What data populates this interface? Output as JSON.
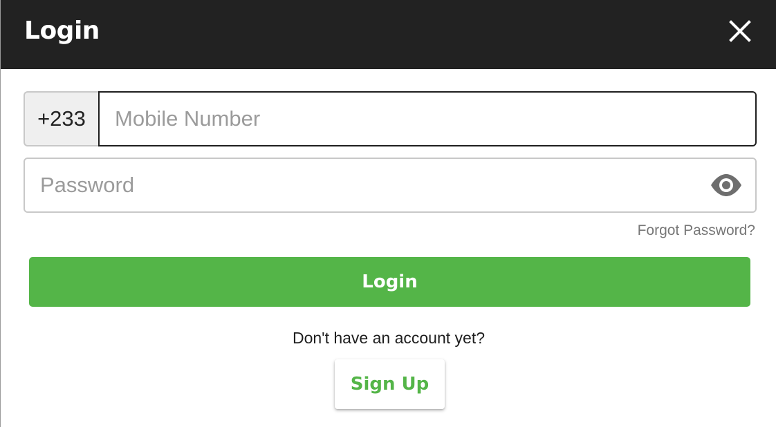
{
  "header": {
    "title": "Login"
  },
  "icons": {
    "close": "close-icon",
    "visibility": "eye-icon"
  },
  "form": {
    "country_code": "+233",
    "mobile_placeholder": "Mobile Number",
    "mobile_value": "",
    "password_placeholder": "Password",
    "password_value": "",
    "forgot_password_label": "Forgot Password?"
  },
  "actions": {
    "login_label": "Login",
    "no_account_text": "Don't have an account yet?",
    "signup_label": "Sign Up"
  },
  "colors": {
    "header_bg": "#222222",
    "accent_green": "#54b548",
    "muted_text": "#777777"
  }
}
